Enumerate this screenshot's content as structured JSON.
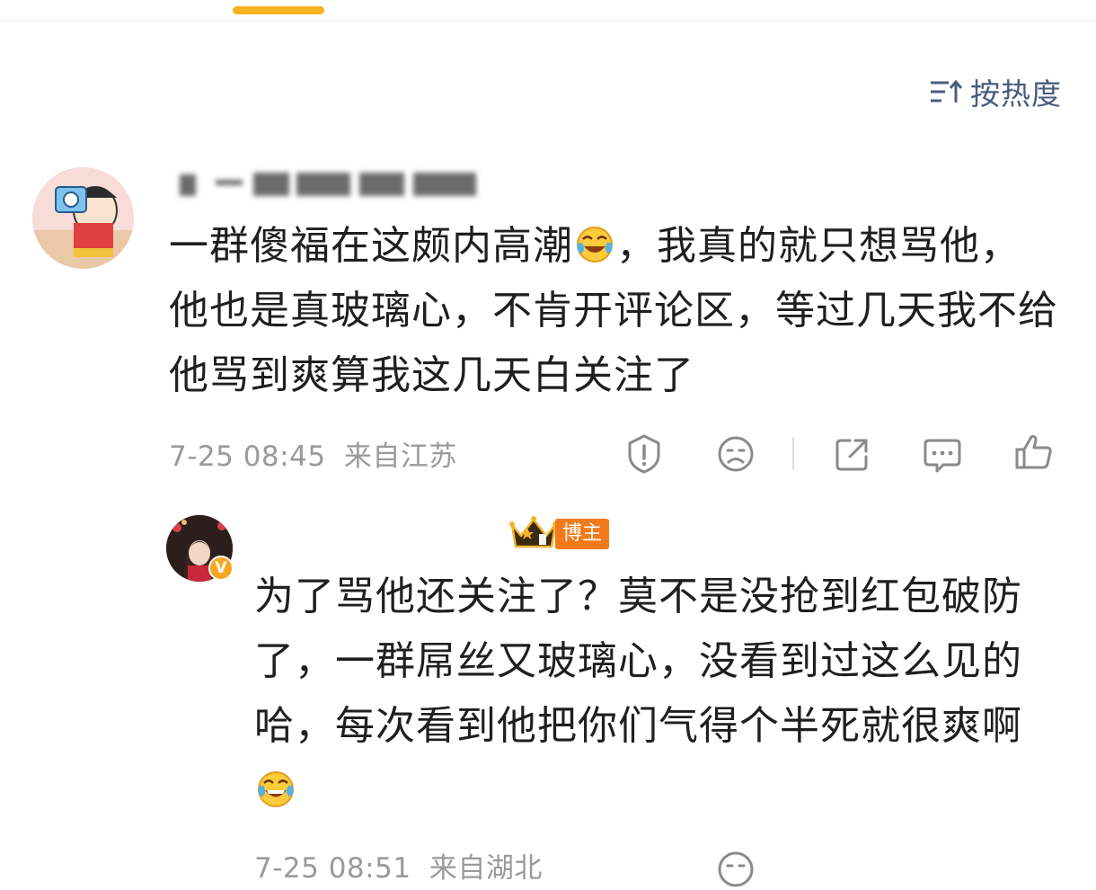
{
  "header": {
    "sort_label": "按热度",
    "sort_icon": "sort-icon",
    "accent_color": "#f7b21f"
  },
  "comment_1": {
    "avatar": "cartoon-avatar",
    "text": "一群傻福在这颇内高潮",
    "emoji": "crying-laughing-emoji",
    "text_after_emoji": "，我真的就只想骂他，他也是真玻璃心，不肯开评论区，等过几天我不给他骂到爽算我这几天白关注了",
    "timestamp": "7-25 08:45",
    "location": "来自江苏",
    "actions": [
      "report-icon",
      "dislike-face-icon",
      "share-icon",
      "comment-icon",
      "like-icon"
    ]
  },
  "reply_1": {
    "avatar": "user-avatar",
    "verified_badge": "V",
    "author_badge": "博主",
    "text": "为了骂他还关注了？莫不是没抢到红包破防了，一群屌丝又玻璃心，没看到过这么见的哈，每次看到他把你们气得个半死就很爽啊",
    "emoji": "laughing-tears-emoji",
    "timestamp": "7-25 08:51",
    "location": "来自湖北"
  }
}
